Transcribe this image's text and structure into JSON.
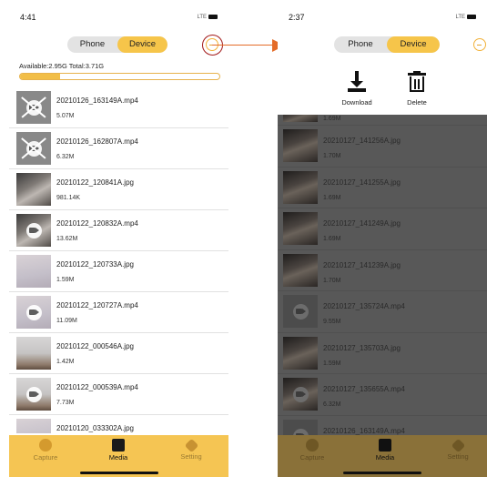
{
  "left_phone": {
    "status": {
      "time": "4:41",
      "signal": "LTE"
    },
    "segment": {
      "phone": "Phone",
      "device": "Device"
    },
    "storage": {
      "text": "Available:2.95G  Total:3.71G",
      "used_fraction": 0.2
    },
    "files": [
      {
        "name": "20210126_163149A.mp4",
        "size": "5.07M",
        "thumb": "gray",
        "video": true,
        "broken": true
      },
      {
        "name": "20210126_162807A.mp4",
        "size": "6.32M",
        "thumb": "gray",
        "video": true,
        "broken": true
      },
      {
        "name": "20210122_120841A.jpg",
        "size": "981.14K",
        "thumb": "room",
        "video": false
      },
      {
        "name": "20210122_120832A.mp4",
        "size": "13.62M",
        "thumb": "room",
        "video": true
      },
      {
        "name": "20210122_120733A.jpg",
        "size": "1.59M",
        "thumb": "wall",
        "video": false
      },
      {
        "name": "20210122_120727A.mp4",
        "size": "11.09M",
        "thumb": "wall",
        "video": true
      },
      {
        "name": "20210122_000546A.jpg",
        "size": "1.42M",
        "thumb": "floor",
        "video": false
      },
      {
        "name": "20210122_000539A.mp4",
        "size": "7.73M",
        "thumb": "floor",
        "video": true
      },
      {
        "name": "20210120_033302A.jpg",
        "size": "",
        "thumb": "wall",
        "video": false
      }
    ],
    "tabs": {
      "capture": "Capture",
      "media": "Media",
      "setting": "Setting"
    }
  },
  "right_phone": {
    "status": {
      "time": "2:37",
      "signal": "LTE"
    },
    "segment": {
      "phone": "Phone",
      "device": "Device"
    },
    "actions": {
      "download": "Download",
      "delete": "Delete"
    },
    "top_partial_size": "1.69M",
    "files": [
      {
        "name": "20210127_141256A.jpg",
        "size": "1.70M",
        "thumb": "room",
        "video": false
      },
      {
        "name": "20210127_141255A.jpg",
        "size": "1.69M",
        "thumb": "room",
        "video": false
      },
      {
        "name": "20210127_141249A.jpg",
        "size": "1.69M",
        "thumb": "room",
        "video": false
      },
      {
        "name": "20210127_141239A.jpg",
        "size": "1.70M",
        "thumb": "room",
        "video": false
      },
      {
        "name": "20210127_135724A.mp4",
        "size": "9.55M",
        "thumb": "gray",
        "video": true
      },
      {
        "name": "20210127_135703A.jpg",
        "size": "1.59M",
        "thumb": "room",
        "video": false
      },
      {
        "name": "20210127_135655A.mp4",
        "size": "6.32M",
        "thumb": "room",
        "video": true
      },
      {
        "name": "20210126_163149A.mp4",
        "size": "",
        "thumb": "gray",
        "video": true
      }
    ],
    "tabs": {
      "capture": "Capture",
      "media": "Media",
      "setting": "Setting"
    }
  },
  "colors": {
    "accent": "#f5c553",
    "arrow": "#e46c28",
    "highlight_circle": "#a21818",
    "overlay": "#585858"
  }
}
